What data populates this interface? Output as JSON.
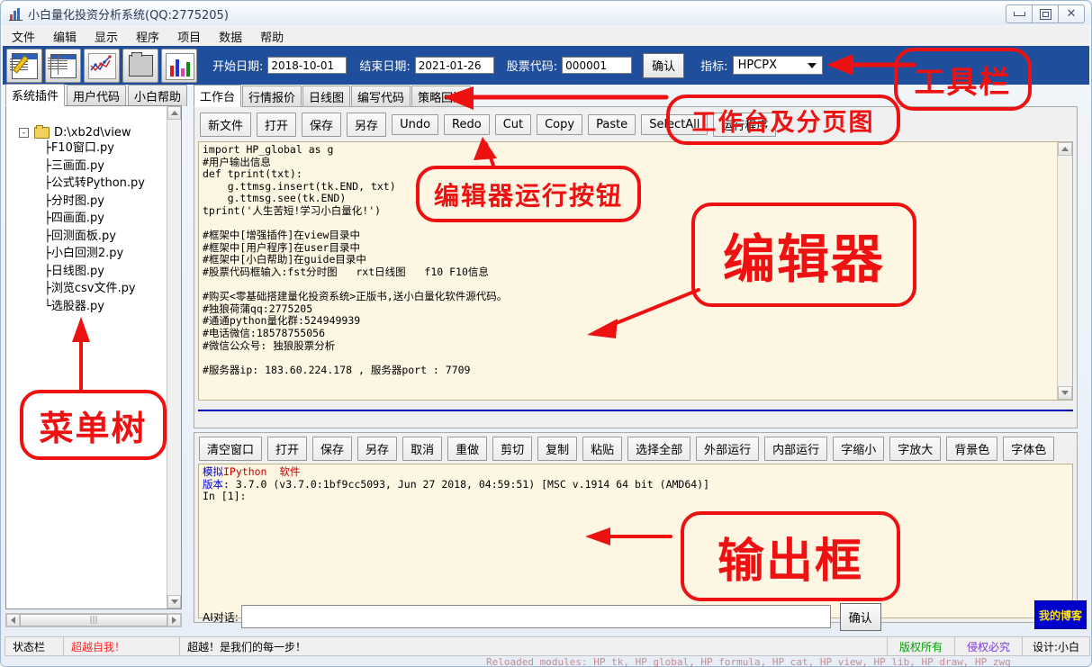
{
  "window": {
    "title": "小白量化投资分析系统(QQ:2775205)",
    "icon": "chart-icon",
    "controls": {
      "minimize": "minimize-icon",
      "maximize": "maximize-icon",
      "close": "close-icon"
    }
  },
  "menubar": {
    "items": [
      "文件",
      "编辑",
      "显示",
      "程序",
      "项目",
      "数据",
      "帮助"
    ]
  },
  "toolbar": {
    "icons": [
      "new-document-icon",
      "table-icon",
      "line-chart-icon",
      "folder-icon",
      "bar-chart-icon"
    ],
    "start_date_label": "开始日期:",
    "start_date_value": "2018-10-01",
    "end_date_label": "结束日期:",
    "end_date_value": "2021-01-26",
    "stock_code_label": "股票代码:",
    "stock_code_value": "000001",
    "confirm_label": "确认",
    "indicator_label": "指标:",
    "indicator_value": "HPCPX",
    "background_color": "#1f4e9c"
  },
  "left_panel": {
    "tabs": [
      "系统插件",
      "用户代码",
      "小白帮助"
    ],
    "active_tab": "系统插件",
    "tree": {
      "root": "D:\\xb2d\\view",
      "expander": "-",
      "items": [
        {
          "branch": "├",
          "label": "F10窗口.py"
        },
        {
          "branch": "├",
          "label": "三画面.py"
        },
        {
          "branch": "├",
          "label": "公式转Python.py"
        },
        {
          "branch": "├",
          "label": "分时图.py"
        },
        {
          "branch": "├",
          "label": "四画面.py"
        },
        {
          "branch": "├",
          "label": "回测面板.py"
        },
        {
          "branch": "├",
          "label": "小白回测2.py"
        },
        {
          "branch": "├",
          "label": "日线图.py"
        },
        {
          "branch": "├",
          "label": "浏览csv文件.py"
        },
        {
          "branch": "└",
          "label": "选股器.py"
        }
      ]
    }
  },
  "right_panel": {
    "tabs": [
      "工作台",
      "行情报价",
      "日线图",
      "编写代码",
      "策略回测"
    ],
    "active_tab": "工作台",
    "editor_buttons": [
      "新文件",
      "打开",
      "保存",
      "另存",
      "Undo",
      "Redo",
      "Cut",
      "Copy",
      "Paste",
      "SelectAll",
      "运行程序"
    ],
    "code": "import HP_global as g\n#用户输出信息\ndef tprint(txt):\n    g.ttmsg.insert(tk.END, txt)\n    g.ttmsg.see(tk.END)\ntprint('人生苦短!学习小白量化!')\n\n#框架中[增强插件]在view目录中\n#框架中[用户程序]在user目录中\n#框架中[小白帮助]在guide目录中\n#股票代码框输入:fst分时图   rxt日线图   f10 F10信息\n\n#购买<零基础搭建量化投资系统>正版书,送小白量化软件源代码。\n#独狼荷蒲qq:2775205\n#通通python量化群:524949939\n#电话微信:18578755056\n#微信公众号: 独狼股票分析\n\n#服务器ip: 183.60.224.178 , 服务器port : 7709",
    "output_buttons": [
      "清空窗口",
      "打开",
      "保存",
      "另存",
      "取消",
      "重做",
      "剪切",
      "复制",
      "粘贴",
      "选择全部",
      "外部运行",
      "内部运行",
      "字缩小",
      "字放大",
      "背景色",
      "字体色"
    ],
    "output": {
      "line1_a": "模拟",
      "line1_b": "IPython",
      "line1_c": "  软件",
      "line2_a": "版本",
      "line2_b": ": 3.7.0 (v3.7.0:1bf9cc5093, Jun 27 2018, 04:59:51) [MSC v.1914 64 bit (AMD64)]",
      "line3": "In [1]:"
    },
    "ai_label": "AI对话:",
    "ai_value": "",
    "ai_placeholder": "",
    "ai_confirm": "确认",
    "blog_button": "我的博客",
    "blog_bg": "#0000cc",
    "blog_fg": "#ffe400"
  },
  "statusbar": {
    "label": "状态栏",
    "slogan": "超越自我！",
    "message": "超越！是我们的每一步！",
    "copyright": "版权所有",
    "infringement": "侵权必究",
    "designer": "设计:小白",
    "slogan_color": "#ff2a2a",
    "copyright_color": "#00a000",
    "infringement_color": "#7a3ad6"
  },
  "annotations": [
    {
      "id": "toolbar-callout",
      "text": "工具栏"
    },
    {
      "id": "workbench-callout",
      "text": "工作台及分页图"
    },
    {
      "id": "run-buttons-callout",
      "text": "编辑器运行按钮"
    },
    {
      "id": "editor-callout",
      "text": "编辑器"
    },
    {
      "id": "output-callout",
      "text": "输出框"
    },
    {
      "id": "menu-tree-callout",
      "text": "菜单树"
    }
  ],
  "bleed": {
    "top": "",
    "bottom": "Reloaded modules: HP_tk, HP_global, HP_formula, HP_cat, HP_view, HP_lib, HP_draw, HP_zwq"
  }
}
